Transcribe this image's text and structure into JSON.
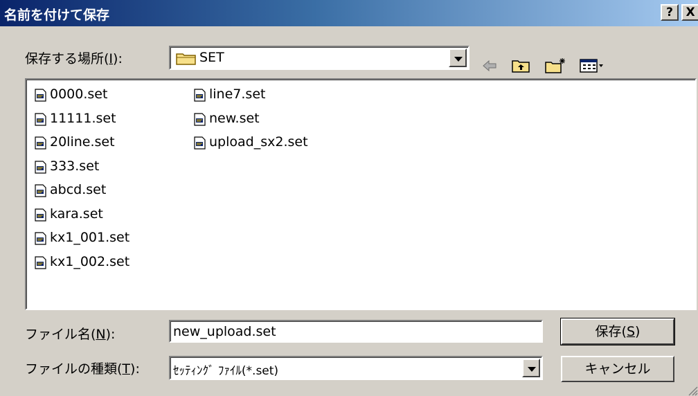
{
  "window": {
    "title": "名前を付けて保存",
    "help_label": "?",
    "close_label": "X"
  },
  "location": {
    "label": "保存する場所(",
    "accel": "I",
    "label_end": "):",
    "value": "SET",
    "icons": [
      "folder-icon",
      "back-arrow-icon",
      "up-folder-icon",
      "new-folder-icon",
      "view-menu-icon"
    ]
  },
  "files": [
    {
      "name": "0000.set"
    },
    {
      "name": "11111.set"
    },
    {
      "name": "20line.set"
    },
    {
      "name": "333.set"
    },
    {
      "name": "abcd.set"
    },
    {
      "name": "kara.set"
    },
    {
      "name": "kx1_001.set"
    },
    {
      "name": "kx1_002.set"
    },
    {
      "name": "line7.set"
    },
    {
      "name": "new.set"
    },
    {
      "name": "upload_sx2.set"
    }
  ],
  "filename": {
    "label": "ファイル名(",
    "accel": "N",
    "label_end": "):",
    "value": "new_upload.set"
  },
  "filetype": {
    "label": "ファイルの種類(",
    "accel": "T",
    "label_end": "):",
    "value": "ｾｯﾃｨﾝｸﾞ ﾌｧｲﾙ(*.set)"
  },
  "buttons": {
    "save": "保存(",
    "save_accel": "S",
    "save_end": ")",
    "cancel": "キャンセル"
  }
}
